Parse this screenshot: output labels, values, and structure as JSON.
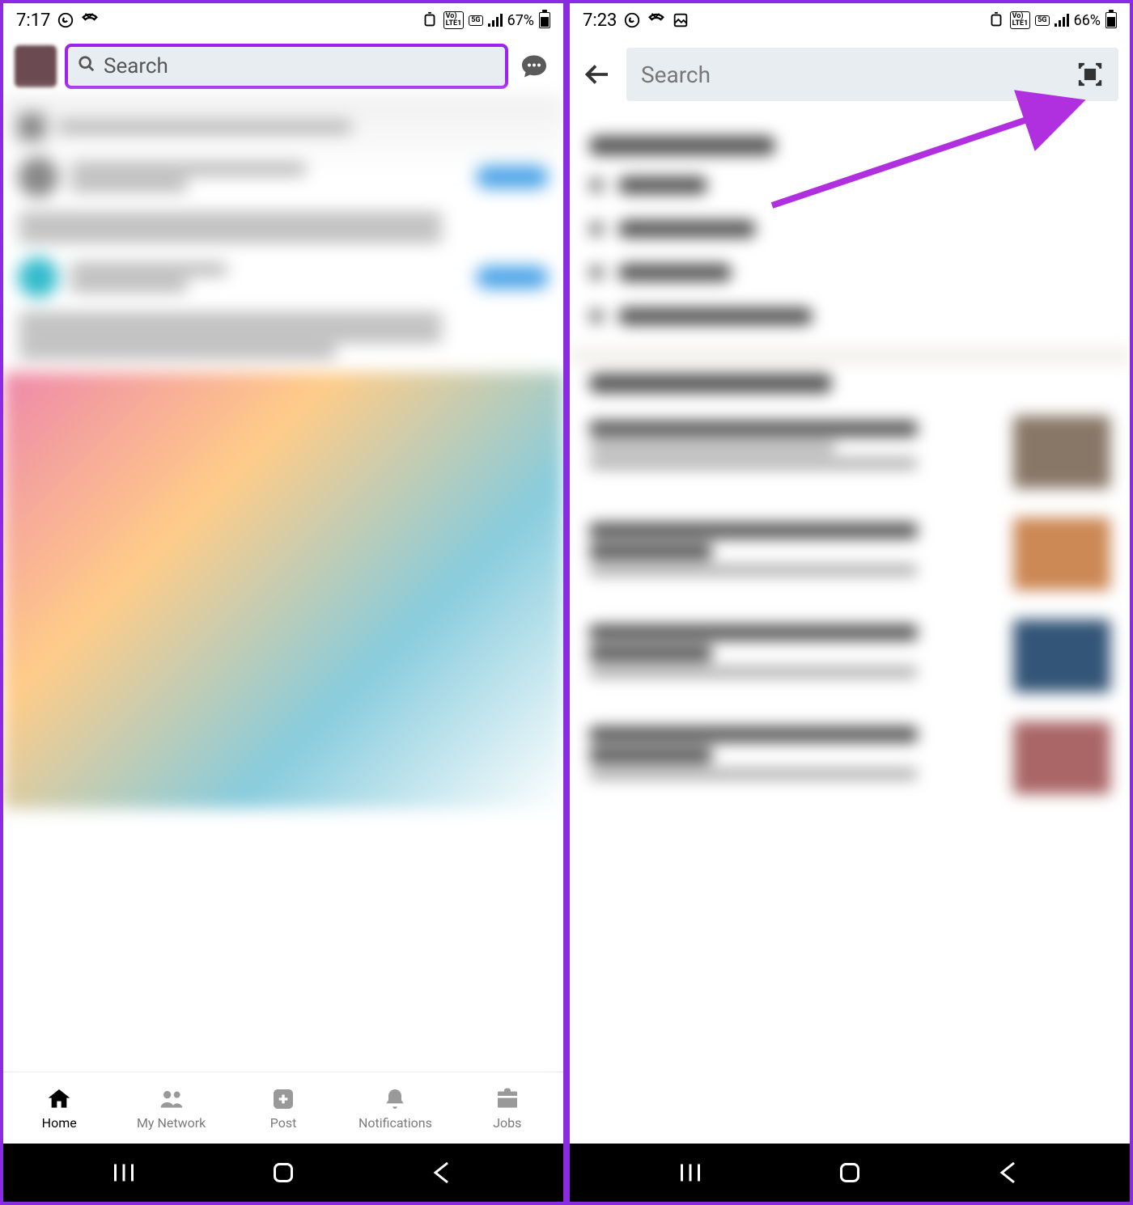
{
  "left": {
    "status": {
      "time": "7:17",
      "battery": "67%"
    },
    "search": {
      "placeholder": "Search"
    },
    "nav": {
      "home": "Home",
      "network": "My Network",
      "post": "Post",
      "notifications": "Notifications",
      "jobs": "Jobs"
    }
  },
  "right": {
    "status": {
      "time": "7:23",
      "battery": "66%"
    },
    "search": {
      "placeholder": "Search"
    }
  }
}
